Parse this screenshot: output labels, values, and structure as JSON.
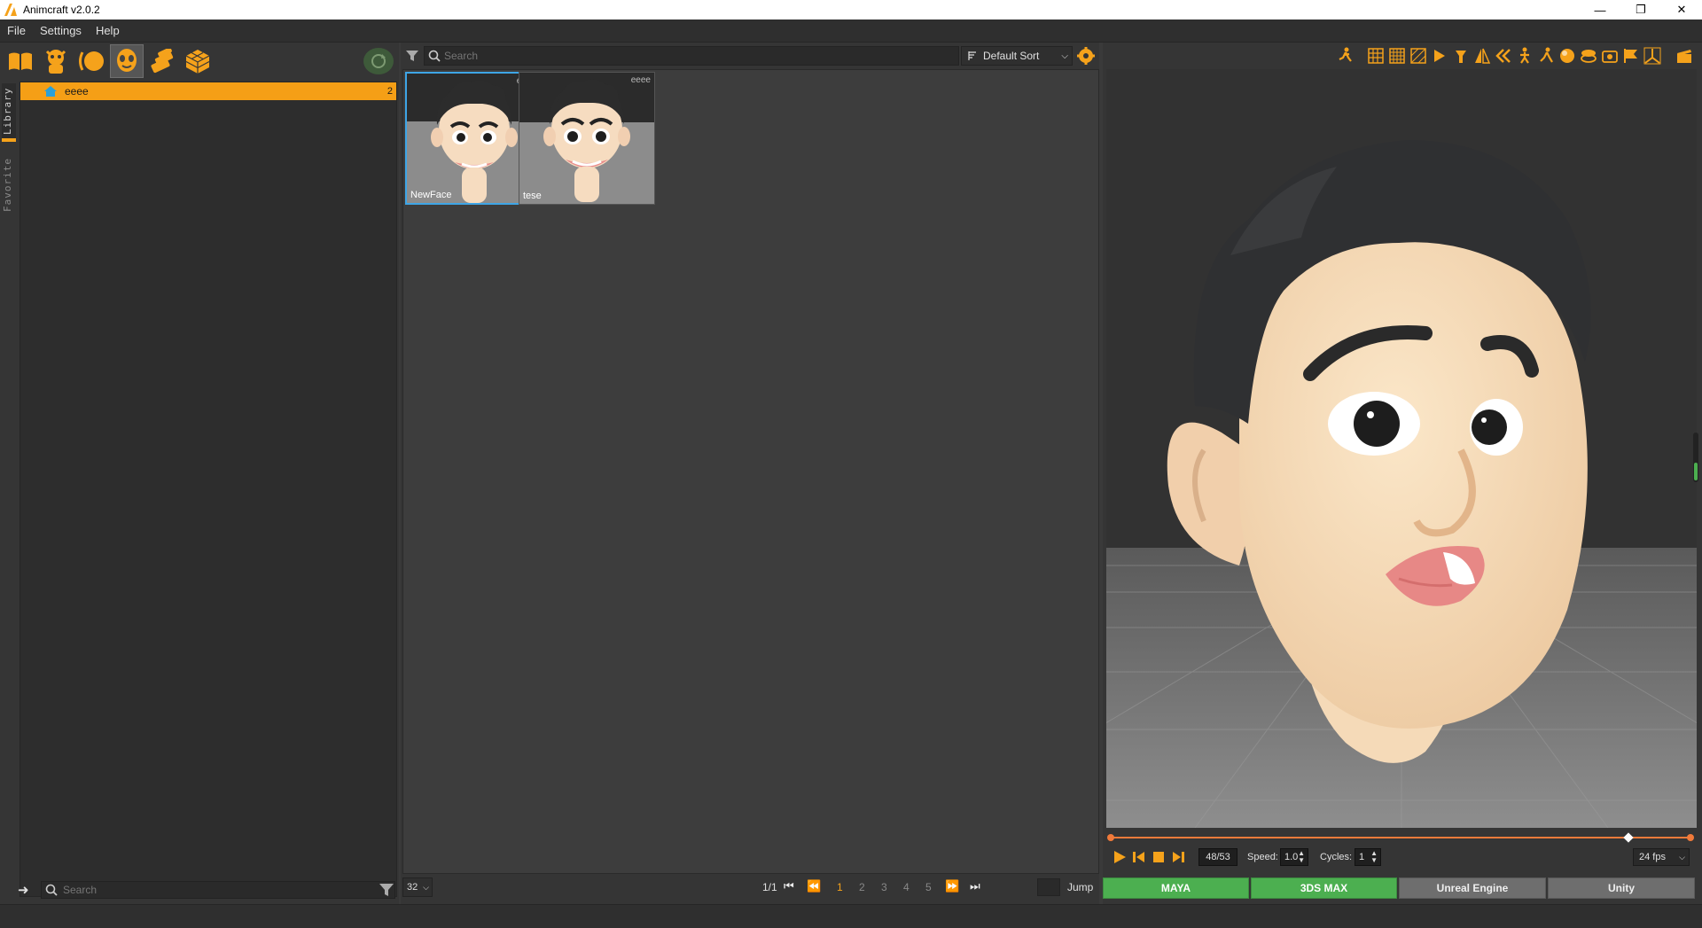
{
  "window": {
    "title": "Animcraft v2.0.2",
    "controls": [
      "minimize",
      "restore",
      "close"
    ]
  },
  "menu": {
    "items": [
      "File",
      "Settings",
      "Help"
    ]
  },
  "library": {
    "toolbar_icons": [
      "book-icon",
      "character-icon",
      "shape-icon",
      "face-icon",
      "motion-icon",
      "cube-icon"
    ],
    "active_icon": "face-icon",
    "tabs": [
      "Library",
      "Favorite"
    ],
    "tree": {
      "folder_label": "eeee",
      "folder_count": "2"
    },
    "search_placeholder": "Search"
  },
  "browser": {
    "search_placeholder": "Search",
    "sort_label": "Default Sort",
    "items": [
      {
        "name": "NewFace",
        "tag": "eeee",
        "selected": true
      },
      {
        "name": "tese",
        "tag": "eeee",
        "selected": false
      }
    ],
    "pager": {
      "page_size": "32",
      "page_info": "1/1",
      "pages": [
        "1",
        "2",
        "3",
        "4",
        "5"
      ],
      "current_page": "1",
      "jump_label": "Jump"
    }
  },
  "viewer": {
    "frame_display": "48/53",
    "frame_current": 48,
    "frame_total": 53,
    "speed_label": "Speed:",
    "speed_value": "1.0",
    "cycles_label": "Cycles:",
    "cycles_value": "1",
    "fps": "24 fps",
    "export_buttons": [
      {
        "label": "MAYA",
        "active": true
      },
      {
        "label": "3DS MAX",
        "active": true
      },
      {
        "label": "Unreal Engine",
        "active": false
      },
      {
        "label": "Unity",
        "active": false
      }
    ],
    "colors": {
      "accent": "#f5a21b",
      "export_active": "#4caf50",
      "timeline": "#f07a3a"
    }
  }
}
